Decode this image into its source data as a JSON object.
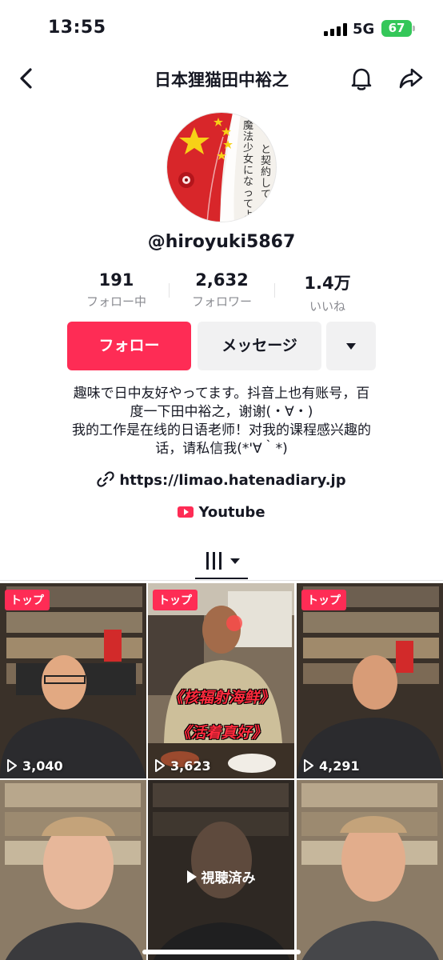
{
  "status_bar": {
    "time": "13:55",
    "network": "5G",
    "battery": "67"
  },
  "header": {
    "title": "日本狸猫田中裕之"
  },
  "avatar": {
    "text_right": "魔法少女になってよ",
    "text_mid": "と契約して"
  },
  "profile": {
    "username": "@hiroyuki5867",
    "stats": [
      {
        "value": "191",
        "label": "フォロー中"
      },
      {
        "value": "2,632",
        "label": "フォロワー"
      },
      {
        "value": "1.4万",
        "label": "いいね"
      }
    ],
    "follow_label": "フォロー",
    "message_label": "メッセージ",
    "bio_lines": [
      "趣味で日中友好やってます。抖音上也有账号，百",
      "度一下田中裕之，谢谢(・∀・)",
      "我的工作是在线的日语老师！对我的课程感兴趣的",
      "话，请私信我(*'∀｀*)"
    ],
    "link": "https://limao.hatenadiary.jp",
    "youtube": "Youtube"
  },
  "videos": [
    {
      "badge": "トップ",
      "views": "3,040"
    },
    {
      "badge": "トップ",
      "views": "3,623",
      "caption1": "《核辐射海鲜》",
      "caption2": "《活着真好》"
    },
    {
      "badge": "トップ",
      "views": "4,291"
    },
    {
      "views": ""
    },
    {
      "watched": "視聴済み"
    },
    {
      "views": ""
    }
  ],
  "colors": {
    "accent": "#fe2c55",
    "secondary_button": "#f1f1f2",
    "muted_text": "#8a8b91"
  }
}
